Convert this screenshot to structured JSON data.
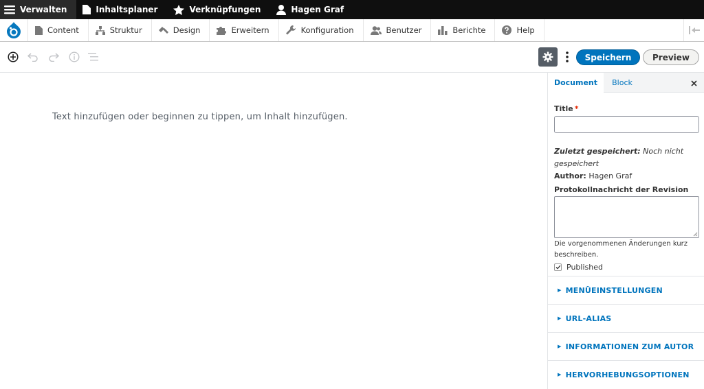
{
  "topbar": {
    "items": [
      {
        "label": "Verwalten",
        "icon": "hamburger-icon"
      },
      {
        "label": "Inhaltsplaner",
        "icon": "document-icon"
      },
      {
        "label": "Verknüpfungen",
        "icon": "star-icon"
      },
      {
        "label": "Hagen Graf",
        "icon": "user-icon"
      }
    ]
  },
  "tray": {
    "items": [
      {
        "label": "Content",
        "icon": "content-icon"
      },
      {
        "label": "Struktur",
        "icon": "structure-icon"
      },
      {
        "label": "Design",
        "icon": "paintbrush-icon"
      },
      {
        "label": "Erweitern",
        "icon": "puzzle-icon"
      },
      {
        "label": "Konfiguration",
        "icon": "wrench-icon"
      },
      {
        "label": "Benutzer",
        "icon": "people-icon"
      },
      {
        "label": "Berichte",
        "icon": "bar-chart-icon"
      },
      {
        "label": "Help",
        "icon": "help-icon"
      }
    ]
  },
  "editor": {
    "save_label": "Speichern",
    "preview_label": "Preview",
    "placeholder": "Text hinzufügen oder beginnen zu tippen, um Inhalt hinzufügen."
  },
  "sidebar": {
    "tab_document": "Document",
    "tab_block": "Block",
    "title_label": "Title",
    "required_mark": "*",
    "last_saved_label": "Zuletzt gespeichert:",
    "last_saved_value": "Noch nicht gespeichert",
    "author_label": "Author:",
    "author_value": "Hagen Graf",
    "revision_label": "Protokollnachricht der Revision",
    "revision_description": "Die vorgenommenen Änderungen kurz beschreiben.",
    "published_label": "Published",
    "published_checked": true,
    "panels": [
      "MENÜEINSTELLUNGEN",
      "URL-ALIAS",
      "INFORMATIONEN ZUM AUTOR",
      "HERVORHEBUNGSOPTIONEN"
    ]
  },
  "colors": {
    "primary": "#0074bd",
    "topbar_bg": "#0f0f0f",
    "required": "#e62600"
  }
}
